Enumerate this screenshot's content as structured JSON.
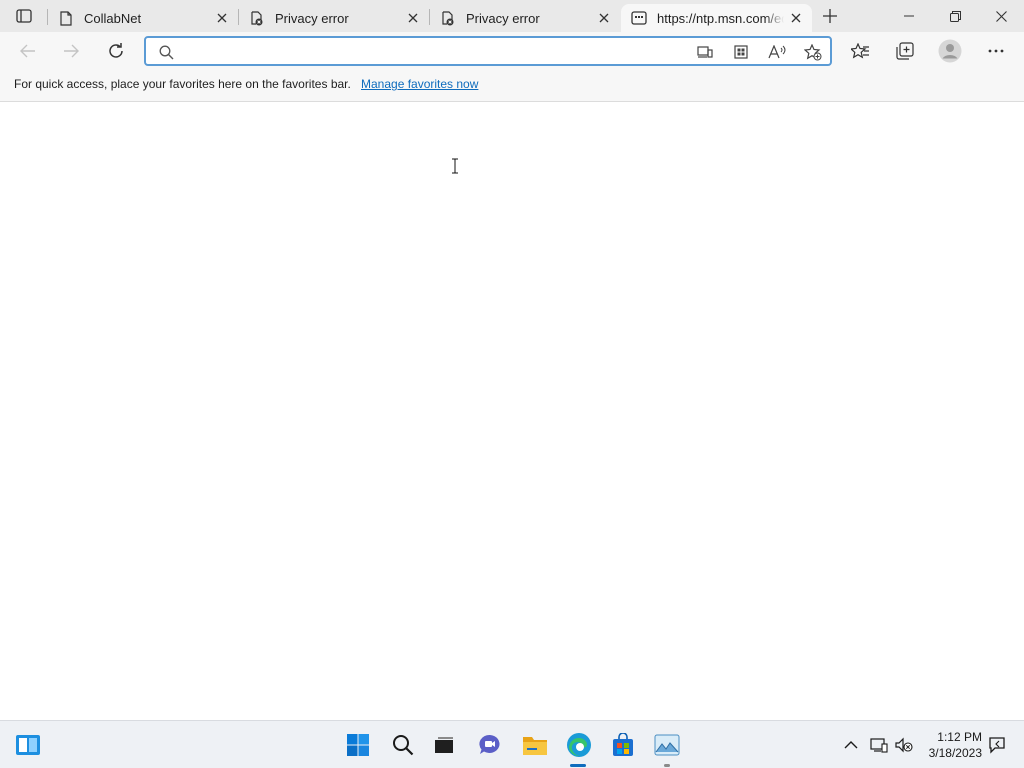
{
  "tabs": [
    {
      "label": "CollabNet",
      "icon": "page-icon",
      "active": false
    },
    {
      "label": "Privacy error",
      "icon": "privacy-error-icon",
      "active": false
    },
    {
      "label": "Privacy error",
      "icon": "privacy-error-icon",
      "active": false
    },
    {
      "label": "https://ntp.msn.com/edge/ntp",
      "icon": "ntp-icon",
      "active": true
    }
  ],
  "address_bar": {
    "value": "",
    "placeholder": ""
  },
  "favorites_bar": {
    "message": "For quick access, place your favorites here on the favorites bar.",
    "link": "Manage favorites now"
  },
  "taskbar": {
    "apps": [
      "widgets",
      "start",
      "search",
      "task-view",
      "chat",
      "file-explorer",
      "edge",
      "store",
      "photos"
    ],
    "clock": {
      "time": "1:12 PM",
      "date": "3/18/2023"
    }
  },
  "colors": {
    "accent": "#0f6cbd",
    "address_border": "#5b9bd5",
    "taskbar_bg": "#eef1f5"
  }
}
